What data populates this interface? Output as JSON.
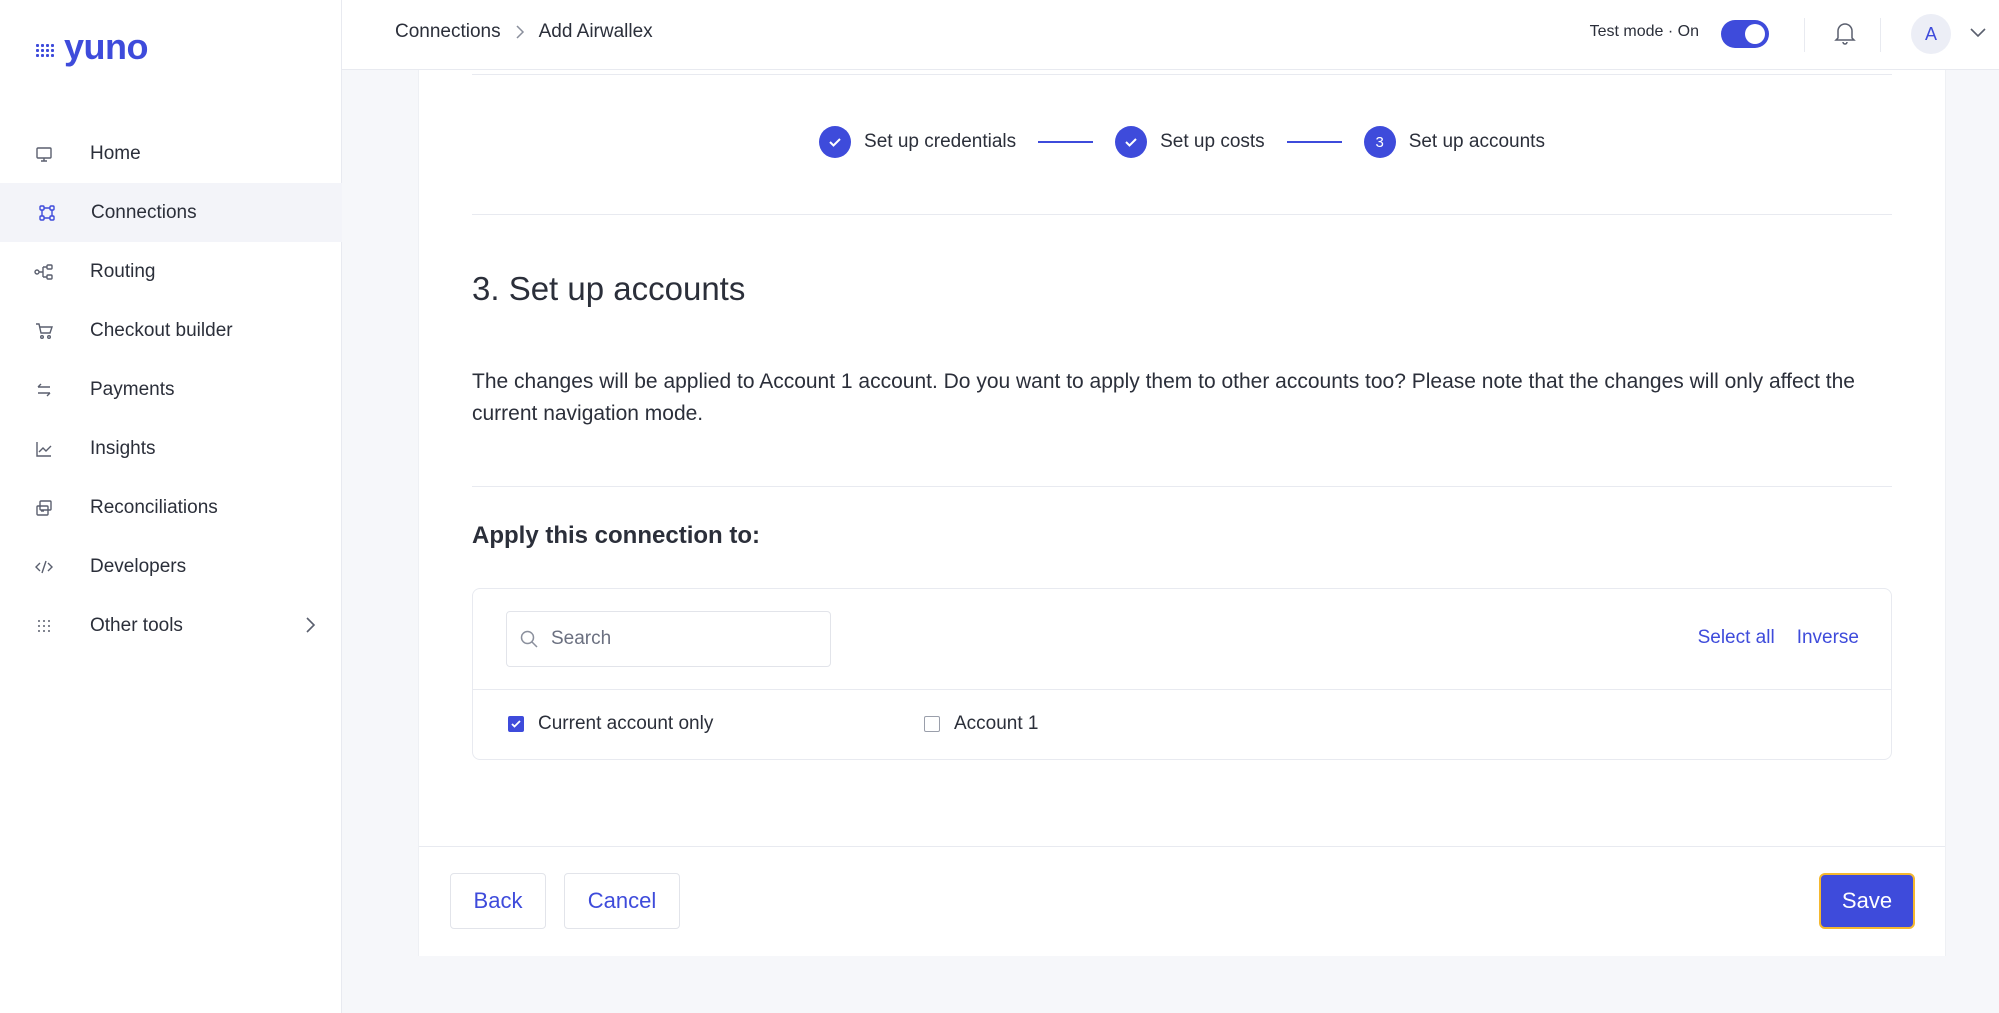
{
  "brand": {
    "name": "yuno",
    "color": "#3e4bdb"
  },
  "sidebar": {
    "items": [
      {
        "label": "Home",
        "icon": "monitor-icon"
      },
      {
        "label": "Connections",
        "icon": "connections-icon",
        "active": true
      },
      {
        "label": "Routing",
        "icon": "routing-icon"
      },
      {
        "label": "Checkout builder",
        "icon": "cart-icon"
      },
      {
        "label": "Payments",
        "icon": "arrows-icon"
      },
      {
        "label": "Insights",
        "icon": "chart-icon"
      },
      {
        "label": "Reconciliations",
        "icon": "reconcile-icon"
      },
      {
        "label": "Developers",
        "icon": "code-icon"
      },
      {
        "label": "Other tools",
        "icon": "grid-dots-icon"
      }
    ]
  },
  "header": {
    "breadcrumb": [
      "Connections",
      "Add Airwallex"
    ],
    "test_mode_label": "Test mode · On",
    "test_mode_on": true,
    "avatar_initial": "A"
  },
  "stepper": {
    "steps": [
      {
        "label": "Set up credentials",
        "state": "done"
      },
      {
        "label": "Set up costs",
        "state": "done"
      },
      {
        "label": "Set up accounts",
        "state": "current",
        "number": "3"
      }
    ]
  },
  "main": {
    "title": "3. Set up accounts",
    "description": "The changes will be applied to Account 1 account. Do you want to apply them to other accounts too? Please note that the changes will only affect the current navigation mode.",
    "apply_title": "Apply this connection to:",
    "search_placeholder": "Search",
    "select_all": "Select all",
    "inverse": "Inverse",
    "options": [
      {
        "label": "Current account only",
        "checked": true
      },
      {
        "label": "Account 1",
        "checked": false
      }
    ]
  },
  "footer": {
    "back": "Back",
    "cancel": "Cancel",
    "save": "Save"
  }
}
